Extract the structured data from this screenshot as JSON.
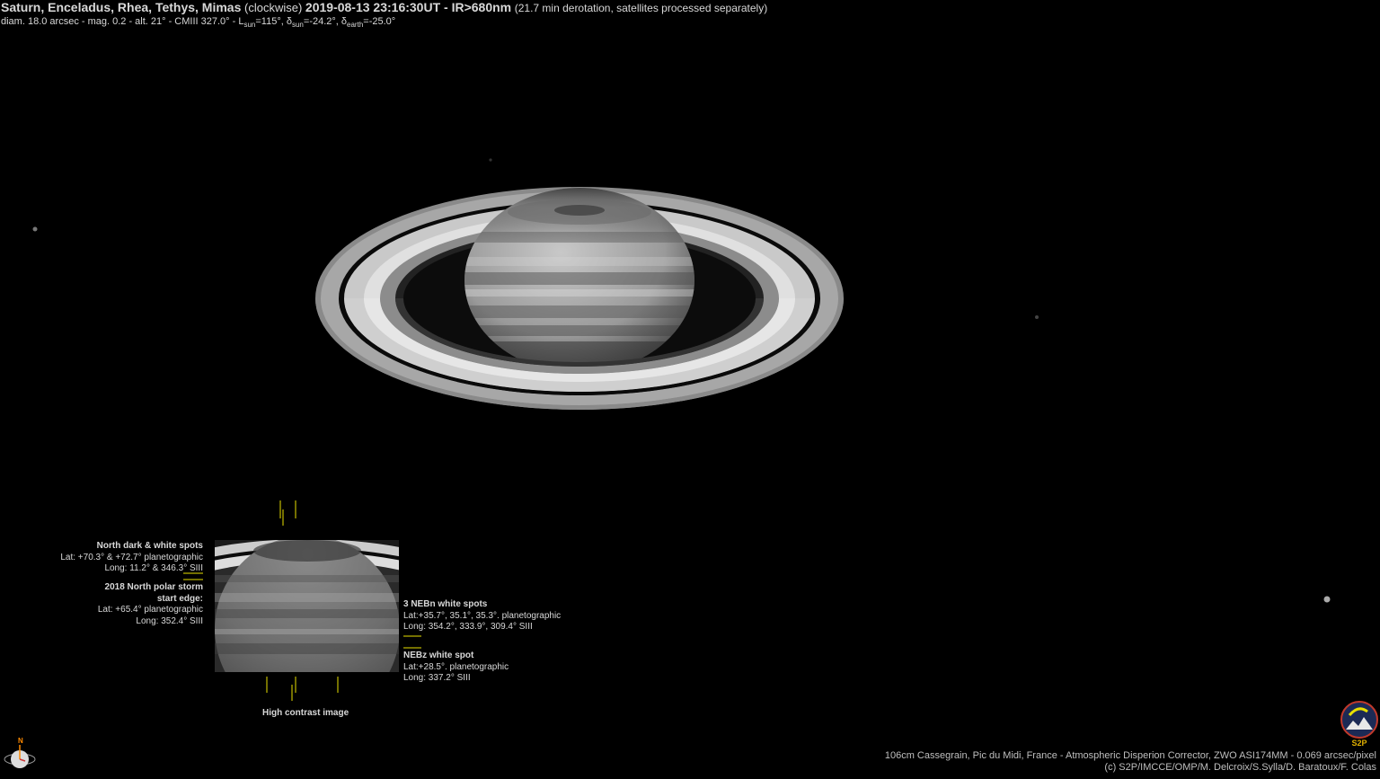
{
  "header": {
    "objects": "Saturn, Enceladus, Rhea, Tethys, Mimas",
    "order_note": "(clockwise)",
    "datetime_filter": "2019-08-13 23:16:30UT - IR>680nm",
    "processing_note": "(21.7 min derotation, satellites processed separately)",
    "params_prefix": "diam. 18.0 arcsec - mag. 0.2 - alt. 21° - CMIII 327.0° - L",
    "lsun_sub": "sun",
    "lsun_value": "=115°, δ",
    "dsun_sub": "sun",
    "dsun_value": "=-24.2°, δ",
    "dearth_sub": "earth",
    "dearth_value": "=-25.0°"
  },
  "annotations": {
    "north_spots": {
      "title": "North dark & white spots",
      "lat": "Lat: +70.3° & +72.7° planetographic",
      "long": "Long: 11.2° & 346.3° SIII"
    },
    "polar_storm": {
      "title_line1": "2018 North polar storm",
      "title_line2": "start edge:",
      "lat": "Lat: +65.4° planetographic",
      "long": "Long: 352.4° SIII"
    },
    "nebn_spots": {
      "title": "3 NEBn white spots",
      "lat": "Lat:+35.7°, 35.1°, 35.3°. planetographic",
      "long": "Long: 354.2°, 333.9°, 309.4° SIII"
    },
    "nebz_spot": {
      "title": "NEBz white spot",
      "lat": "Lat:+28.5°. planetographic",
      "long": "Long: 337.2° SIII"
    },
    "inset_caption": "High contrast image"
  },
  "footer": {
    "instrument": "106cm Cassegrain, Pic du Midi, France - Atmospheric Disperion Corrector, ZWO ASI174MM - 0.069 arcsec/pixel",
    "credits": "(c) S2P/IMCCE/OMP/M. Delcroix/S.Sylla/D. Baratoux/F. Colas"
  },
  "compass": {
    "north_label": "N"
  },
  "logo": {
    "text": "S2P"
  },
  "colors": {
    "marker": "#e8e000",
    "compass_north": "#ff8a00",
    "logo_ring": "#c0392b"
  }
}
